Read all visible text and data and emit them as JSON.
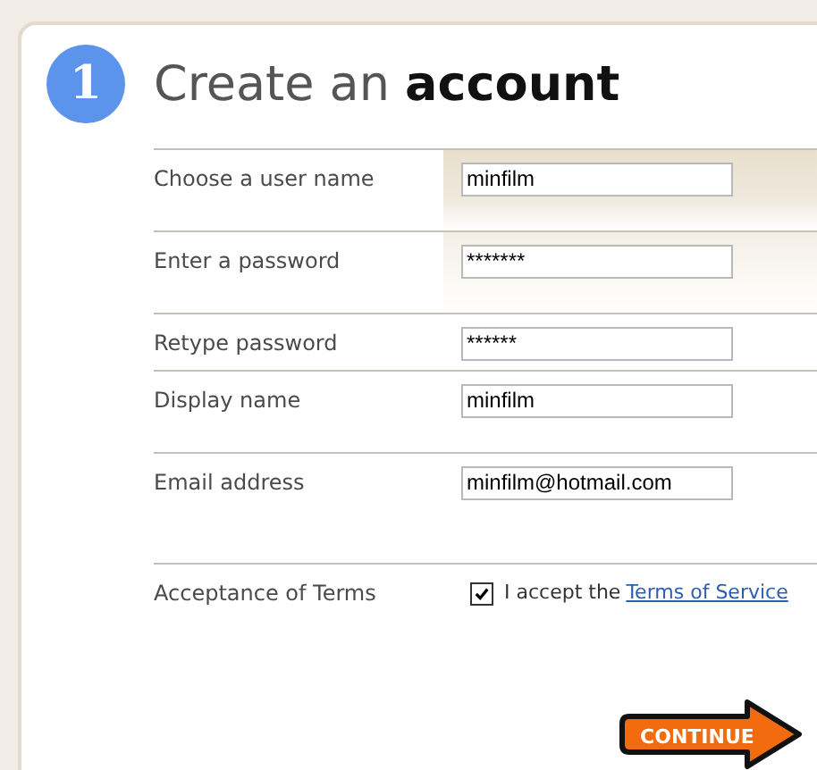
{
  "step": {
    "number": "1"
  },
  "title": {
    "text": "Create an **account**"
  },
  "fields": [
    {
      "label": "Choose a user name",
      "value": "minfilm"
    },
    {
      "label": "Enter a password",
      "value": "*******"
    },
    {
      "label": "Retype password",
      "value": "******"
    },
    {
      "label": "Display name",
      "value": "minfilm"
    },
    {
      "label": "Email address",
      "value": "minfilm@hotmail.com"
    }
  ],
  "terms": {
    "label": "Acceptance of Terms",
    "checked": true,
    "text": "I accept the",
    "link": "Terms of Service"
  },
  "continue_button": {
    "label": "CONTINUE"
  }
}
